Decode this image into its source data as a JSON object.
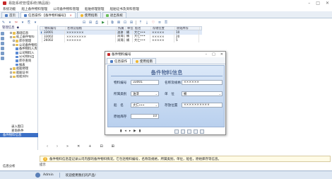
{
  "app": {
    "title": "易能系统管理系统(精品版)"
  },
  "menubar": [
    "系统功能",
    "船上备件物料管理",
    "公司备件物料管理",
    "船舶修理管理",
    "船舶证书及资料管理"
  ],
  "tabs": [
    {
      "label": "首页"
    },
    {
      "label": "信息操作:【备件物料编号】",
      "close": "×"
    },
    {
      "label": "使用指南"
    },
    {
      "label": "退出系统"
    }
  ],
  "left_panel": {
    "header": [
      "管理信息",
      "◆"
    ],
    "tree": [
      {
        "label": "基础信息",
        "indent": 0,
        "box": "+",
        "icon": "folder"
      },
      {
        "label": "船上备件物料",
        "indent": 0,
        "box": "-",
        "icon": "folder"
      },
      {
        "label": "库存管理",
        "indent": 1,
        "box": "-",
        "icon": "folder"
      },
      {
        "label": "公司备件物料",
        "indent": 1,
        "box": "-",
        "icon": "folder"
      },
      {
        "label": "备件物料入库",
        "indent": 2,
        "box": "",
        "icon": "file"
      },
      {
        "label": "公司物料入",
        "indent": 2,
        "box": "",
        "icon": "file"
      },
      {
        "label": "公司物料出",
        "indent": 2,
        "box": "",
        "icon": "file"
      },
      {
        "label": "库存查询",
        "indent": 2,
        "box": "",
        "icon": "file"
      },
      {
        "label": "报表",
        "indent": 2,
        "box": "",
        "icon": "file"
      },
      {
        "label": "船舶修理",
        "indent": 0,
        "box": "+",
        "icon": "folder"
      },
      {
        "label": "船舶证书",
        "indent": 0,
        "box": "+",
        "icon": "folder"
      },
      {
        "label": "船舶资料",
        "indent": 0,
        "box": "+",
        "icon": "folder"
      }
    ],
    "bottom_items": [
      "录入窗口",
      "查询条件",
      "备件物料信息"
    ],
    "bottom_active": 2,
    "footer": "信息分析"
  },
  "grid": {
    "columns": [
      "",
      "物料编号",
      "名称及规格",
      "所属",
      "单位",
      "船名",
      "存储位置",
      "原始库存"
    ],
    "rows": [
      [
        "▶",
        "33001",
        "×××××××",
        "油漆",
        "桶",
        "大仁•••",
        "×××××",
        "10"
      ],
      [
        "",
        "33002",
        "××××××××",
        "润滑油",
        "桶",
        "大仁•••",
        "×××××",
        "20"
      ],
      [
        "",
        "26002",
        "××××××",
        "润滑油",
        "桶",
        "大仁•••",
        "×××××",
        "5"
      ]
    ]
  },
  "toolbar_left": [
    "✎",
    "▾",
    "✂",
    "▾",
    "⎘",
    "▾"
  ],
  "toolbar_right": [
    "⊟",
    "⊞",
    "⎙",
    "▶",
    "⧉",
    "⊠",
    "⊡",
    "⊞",
    "⤒",
    "⤓",
    "♡",
    "≡",
    "⚿"
  ],
  "grid_footer": [
    "‹",
    "›",
    "»",
    "✕",
    "+",
    "⊟",
    "⊞"
  ],
  "dialog": {
    "title": "备件物料编号",
    "tabs": [
      "信息操作",
      "使用指南"
    ],
    "form_title": "备件物料信息",
    "fields": {
      "code": {
        "label": "物料编号",
        "value": "33001"
      },
      "name": {
        "label": "名称及规格",
        "value": "××××××"
      },
      "category": {
        "label": "所属类别",
        "value": "油漆"
      },
      "unit": {
        "label": "单　位",
        "value": "桶"
      },
      "ship": {
        "label": "船　名",
        "value": "大仁•••"
      },
      "location": {
        "label": "存放位置",
        "value": "××××××××××"
      },
      "stock": {
        "label": "原始库存",
        "value": "10"
      }
    },
    "nav": [
      "▮",
      "◂",
      "▸",
      "▶",
      "▮"
    ]
  },
  "hint": {
    "text": "备件物料信息是记录公司内部的备件物料情况。它包括物料编号，名称及规格，所属类别，单位，船名，原始库存等信息。"
  },
  "hint_label": "提示",
  "status": {
    "user": "Admin",
    "message": "欢迎使用我们的产品!"
  },
  "colors": {
    "accent": "#3b6fc5",
    "form_title": "#1d3b73",
    "hint_bg": "#fffbe6"
  }
}
